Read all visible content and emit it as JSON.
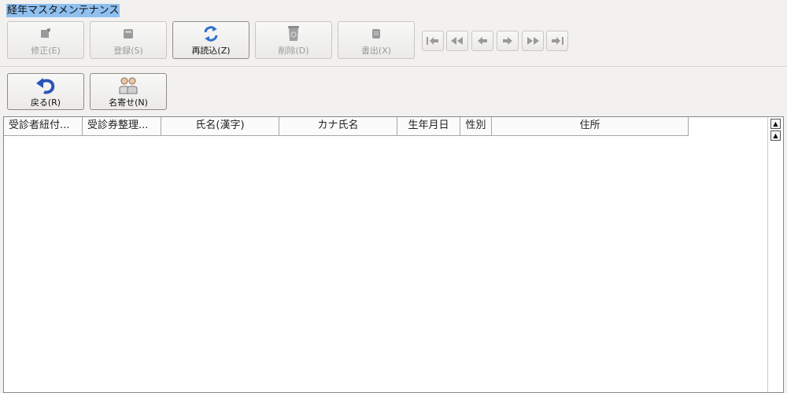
{
  "window": {
    "title": "経年マスタメンテナンス"
  },
  "toolbar": {
    "buttons": [
      {
        "label": "修正(E)",
        "icon": "edit-icon",
        "enabled": false
      },
      {
        "label": "登録(S)",
        "icon": "save-icon",
        "enabled": false
      },
      {
        "label": "再読込(Z)",
        "icon": "reload-icon",
        "enabled": true
      },
      {
        "label": "削除(D)",
        "icon": "trash-icon",
        "enabled": false
      },
      {
        "label": "書出(X)",
        "icon": "export-icon",
        "enabled": false
      }
    ],
    "nav": [
      {
        "icon": "first-record-icon"
      },
      {
        "icon": "fast-rewind-icon"
      },
      {
        "icon": "previous-record-icon"
      },
      {
        "icon": "next-record-icon"
      },
      {
        "icon": "fast-forward-icon"
      },
      {
        "icon": "last-record-icon"
      }
    ]
  },
  "toolbar2": {
    "back_label": "戻る(R)",
    "name_search_label": "名寄せ(N)"
  },
  "table": {
    "columns": [
      "受診者紐付...",
      "受診券整理...",
      "氏名(漢字)",
      "カナ氏名",
      "生年月日",
      "性別",
      "住所"
    ],
    "rows": []
  },
  "colors": {
    "title_highlight": "#8fc0f0",
    "window_bg": "#f2f1f0",
    "reload_icon": "#2f6fd0",
    "back_icon": "#2b55b8"
  }
}
